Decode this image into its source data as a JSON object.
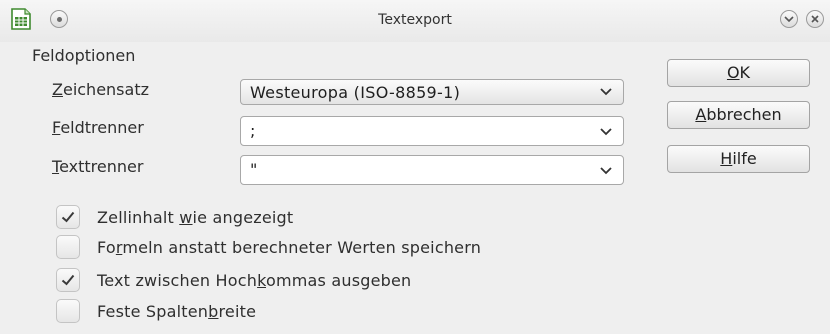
{
  "window": {
    "title": "Textexport",
    "app_icon": "calc-spreadsheet-icon",
    "controls": [
      "menu-circle-icon",
      "minimize-chevron-icon",
      "close-icon"
    ]
  },
  "section": {
    "label": "Feldoptionen"
  },
  "fields": {
    "charset": {
      "label_mnemonic": "Z",
      "label_rest": "eichensatz",
      "value": "Westeuropa (ISO-8859-1)"
    },
    "field_sep": {
      "label_mnemonic": "F",
      "label_rest": "eldtrenner",
      "value": ";"
    },
    "text_sep": {
      "label_mnemonic": "T",
      "label_rest": "exttrenner",
      "value": "\""
    }
  },
  "buttons": {
    "ok": {
      "mnemonic": "O",
      "rest": "K"
    },
    "cancel": {
      "mnemonic": "A",
      "rest": "bbrechen"
    },
    "help": {
      "mnemonic": "H",
      "rest": "ilfe"
    }
  },
  "options": [
    {
      "pre": "Zellinhalt ",
      "mnemonic": "w",
      "post": "ie angezeigt",
      "checked": true
    },
    {
      "pre": "Fo",
      "mnemonic": "r",
      "post": "meln anstatt berechneter Werten speichern",
      "checked": false
    },
    {
      "pre": "Text zwischen Hoch",
      "mnemonic": "k",
      "post": "ommas ausgeben",
      "checked": true
    },
    {
      "pre": "Feste Spalten",
      "mnemonic": "b",
      "post": "reite",
      "checked": false
    }
  ],
  "colors": {
    "background": "#efefef",
    "app_icon_green": "#3f8a2f"
  }
}
